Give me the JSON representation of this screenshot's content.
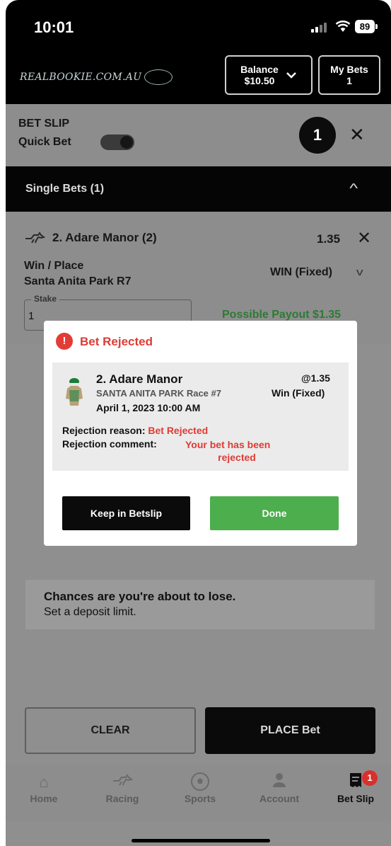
{
  "status_bar": {
    "time": "10:01",
    "battery": "89"
  },
  "header": {
    "logo_text": "REALBOOKIE.COM.AU",
    "balance_label": "Balance",
    "balance_value": "$10.50",
    "my_bets_label": "My Bets",
    "my_bets_count": "1"
  },
  "bet_slip": {
    "title": "BET SLIP",
    "quick_bet_label": "Quick Bet",
    "quick_bet_enabled": true,
    "count": "1",
    "singles_title": "Single Bets (1)",
    "selection_name": "2. Adare Manor (2)",
    "odds": "1.35",
    "bet_type": "Win / Place",
    "venue": "Santa Anita Park R7",
    "bet_option": "WIN (Fixed)",
    "stake_label": "Stake",
    "stake_value": "1",
    "payout": "Possible Payout $1.35"
  },
  "modal": {
    "title": "Bet Rejected",
    "runner": "2. Adare Manor",
    "odds": "@1.35",
    "race": "SANTA ANITA PARK Race #7",
    "bet_option": "Win (Fixed)",
    "date": "April 1, 2023 10:00 AM",
    "reason_label": "Rejection reason:",
    "reason_value": "Bet Rejected",
    "comment_label": "Rejection comment:",
    "comment_line1": "Your bet has been",
    "comment_line2": "rejected",
    "keep_button": "Keep in Betslip",
    "done_button": "Done"
  },
  "warning": {
    "title": "Chances are you're about to lose.",
    "subtitle": "Set a deposit limit."
  },
  "actions": {
    "clear": "CLEAR",
    "place": "PLACE Bet"
  },
  "tabs": [
    {
      "label": "Home",
      "icon": "home-icon"
    },
    {
      "label": "Racing",
      "icon": "horse-icon"
    },
    {
      "label": "Sports",
      "icon": "soccer-ball-icon"
    },
    {
      "label": "Account",
      "icon": "person-icon"
    },
    {
      "label": "Bet Slip",
      "icon": "betslip-icon",
      "badge": "1"
    }
  ],
  "colors": {
    "reject_red": "#e03a33",
    "done_green": "#4cae4c",
    "payout_green": "#2e7a34"
  }
}
